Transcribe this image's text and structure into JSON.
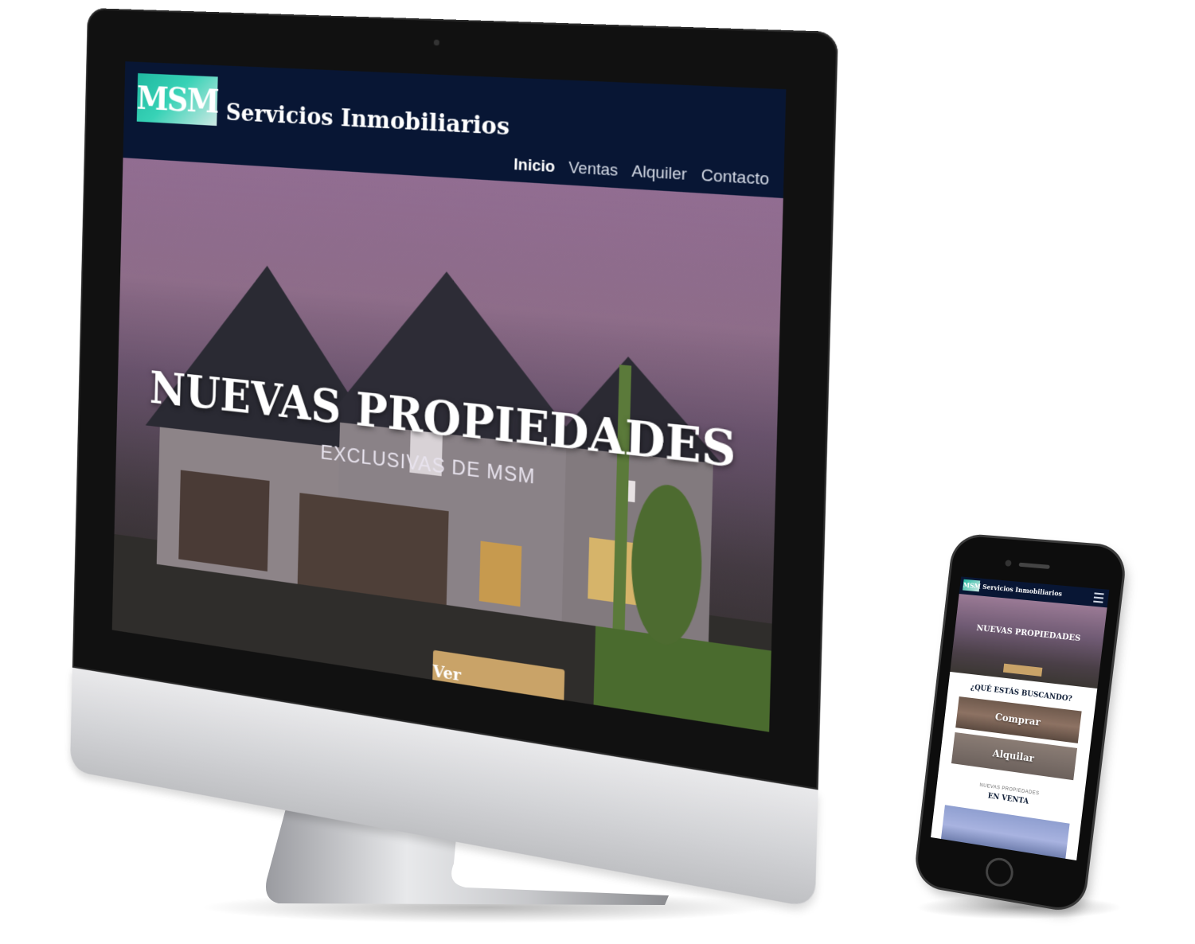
{
  "desktop": {
    "logo_text": "MSM",
    "brand": "Servicios Inmobiliarios",
    "nav": [
      "Inicio",
      "Ventas",
      "Alquiler",
      "Contacto"
    ],
    "hero_title": "NUEVAS PROPIEDADES",
    "hero_subtitle": "EXCLUSIVAS DE MSM",
    "hero_button": "Ver propiedades"
  },
  "mobile": {
    "logo_text": "MSM",
    "brand": "Servicios Inmobiliarios",
    "hero_title": "NUEVAS PROPIEDADES",
    "question": "¿QUÉ ESTÁS BUSCANDO?",
    "card_buy": "Comprar",
    "card_rent": "Alquilar",
    "section_kicker": "NUEVAS PROPIEDADES",
    "section_title": "EN VENTA"
  },
  "colors": {
    "header_navy": "#081634",
    "logo_teal": "#1fb8a0",
    "button_gold": "#c9a368"
  }
}
